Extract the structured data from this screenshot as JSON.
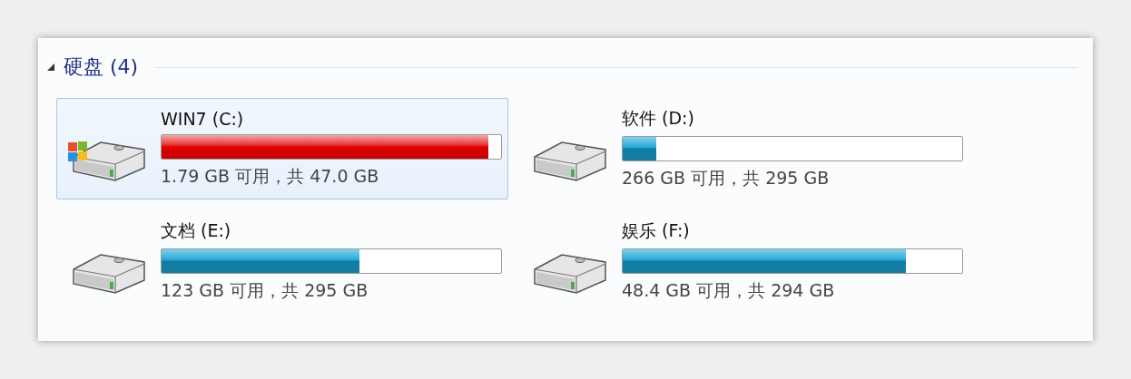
{
  "group": {
    "title": "硬盘 (4)",
    "expanded": true
  },
  "drives": [
    {
      "kind": "system",
      "name": "WIN7 (C:)",
      "level": 0.962,
      "low_space": true,
      "selected": true,
      "space": "1.79 GB 可用，共 47.0 GB"
    },
    {
      "kind": "disk",
      "name": "软件 (D:)",
      "level": 0.098,
      "low_space": false,
      "selected": false,
      "space": "266 GB 可用，共 295 GB"
    },
    {
      "kind": "disk",
      "name": "文档 (E:)",
      "level": 0.583,
      "low_space": false,
      "selected": false,
      "space": "123 GB 可用，共 295 GB"
    },
    {
      "kind": "disk",
      "name": "娱乐 (F:)",
      "level": 0.835,
      "low_space": false,
      "selected": false,
      "space": "48.4 GB 可用，共 294 GB"
    }
  ]
}
